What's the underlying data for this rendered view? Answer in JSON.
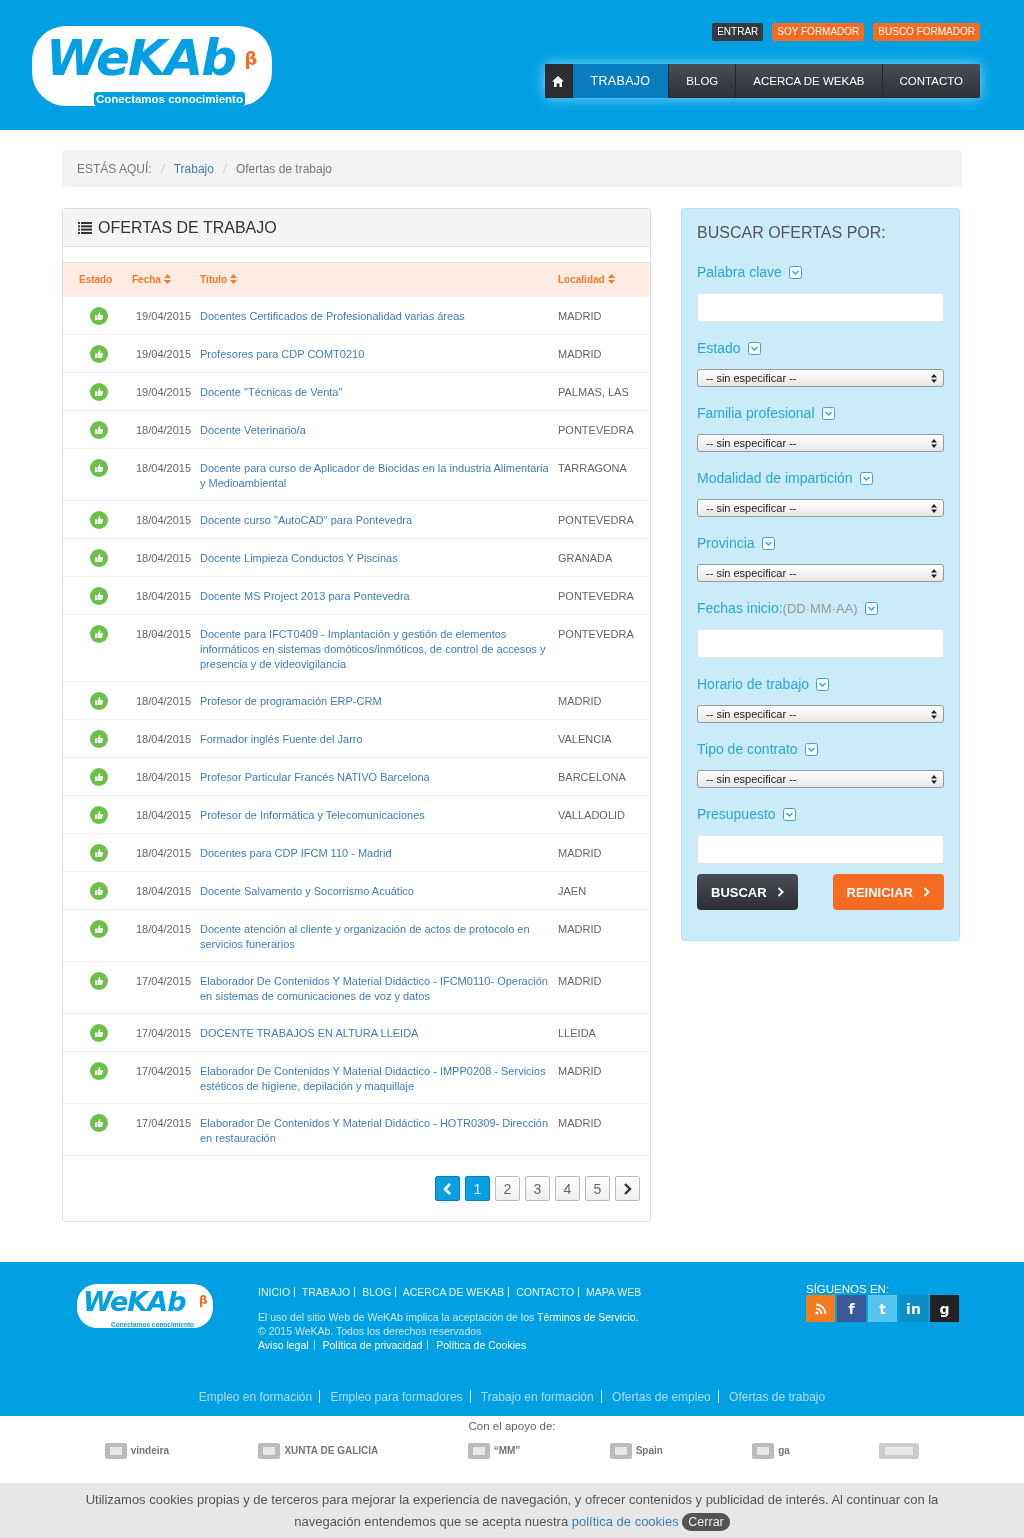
{
  "header": {
    "logo": {
      "name": "WeKAb",
      "beta": "β",
      "tagline": "Conectamos conocimiento"
    },
    "top_buttons": [
      {
        "label": "ENTRAR",
        "kind": "dark"
      },
      {
        "label": "SOY FORMADOR",
        "kind": "orange"
      },
      {
        "label": "BUSCO FORMADOR",
        "kind": "orange"
      }
    ],
    "nav": [
      {
        "label": "TRABAJO",
        "selected": true
      },
      {
        "label": "BLOG",
        "selected": false
      },
      {
        "label": "ACERCA DE WEKAB",
        "selected": false
      },
      {
        "label": "CONTACTO",
        "selected": false
      }
    ]
  },
  "breadcrumb": {
    "prefix": "ESTÁS AQUÍ:",
    "items": [
      {
        "label": "Trabajo",
        "link": true
      },
      {
        "label": "Ofertas de trabajo",
        "link": false
      }
    ]
  },
  "offers": {
    "title": "OFERTAS DE TRABAJO",
    "columns": [
      {
        "label": "Estado",
        "sortable": false
      },
      {
        "label": "Fecha",
        "sortable": true
      },
      {
        "label": "Título",
        "sortable": true
      },
      {
        "label": "Localidad",
        "sortable": true
      }
    ],
    "rows": [
      {
        "date": "19/04/2015",
        "title": "Docentes Certificados de Profesionalidad varias áreas",
        "location": "MADRID"
      },
      {
        "date": "19/04/2015",
        "title": "Profesores para CDP COMT0210",
        "location": "MADRID"
      },
      {
        "date": "19/04/2015",
        "title": "Docente \"Técnicas de Venta\"",
        "location": "PALMAS, LAS"
      },
      {
        "date": "18/04/2015",
        "title": "Docente Veterinario/a",
        "location": "PONTEVEDRA"
      },
      {
        "date": "18/04/2015",
        "title": "Docente para curso de Aplicador de Biocidas en la industria Alimentaria y Medioambiental",
        "location": "TARRAGONA"
      },
      {
        "date": "18/04/2015",
        "title": "Docente curso \"AutoCAD\" para Pontevedra",
        "location": "PONTEVEDRA"
      },
      {
        "date": "18/04/2015",
        "title": "Docente Limpieza Conductos Y Piscinas",
        "location": "GRANADA"
      },
      {
        "date": "18/04/2015",
        "title": "Docente MS Project 2013 para Pontevedra",
        "location": "PONTEVEDRA"
      },
      {
        "date": "18/04/2015",
        "title": "Docente para IFCT0409 - Implantación y gestión de elementos informáticos en sistemas domóticos/inmóticos, de control de accesos y presencia y de videovigilancia",
        "location": "PONTEVEDRA"
      },
      {
        "date": "18/04/2015",
        "title": "Profesor de programación ERP-CRM",
        "location": "MADRID"
      },
      {
        "date": "18/04/2015",
        "title": "Formador inglés Fuente del Jarro",
        "location": "VALENCIA"
      },
      {
        "date": "18/04/2015",
        "title": "Profesor Particular Francés NATIVO Barcelona",
        "location": "BARCELONA"
      },
      {
        "date": "18/04/2015",
        "title": "Profesor de Informática y Telecomunicaciones",
        "location": "VALLADOLID"
      },
      {
        "date": "18/04/2015",
        "title": "Docentes para CDP IFCM 110 - Madrid",
        "location": "MADRID"
      },
      {
        "date": "18/04/2015",
        "title": "Docente Salvamento y Socorrismo Acuático",
        "location": "JAEN"
      },
      {
        "date": "18/04/2015",
        "title": "Docente atención al cliente y organización de actos de protocolo en servicios funerarios",
        "location": "MADRID"
      },
      {
        "date": "17/04/2015",
        "title": "Elaborador De Contenidos Y Material Didáctico - IFCM0110- Operación en sistemas de comunicaciones de voz y datos",
        "location": "MADRID"
      },
      {
        "date": "17/04/2015",
        "title": "DOCENTE TRABAJOS EN ALTURA LLEIDA",
        "location": "LLEIDA"
      },
      {
        "date": "17/04/2015",
        "title": "Elaborador De Contenidos Y Material Didáctico - IMPP0208 - Servicios estéticos de higiene, depilación y maquillaje",
        "location": "MADRID"
      },
      {
        "date": "17/04/2015",
        "title": "Elaborador De Contenidos Y Material Didáctico - HOTR0309- Dirección en restauración",
        "location": "MADRID"
      }
    ],
    "pagination": [
      {
        "label": "1",
        "selected": true
      },
      {
        "label": "2",
        "selected": false
      },
      {
        "label": "3",
        "selected": false
      },
      {
        "label": "4",
        "selected": false
      },
      {
        "label": "5",
        "selected": false
      }
    ]
  },
  "search": {
    "title": "BUSCAR OFERTAS POR:",
    "filters": [
      {
        "label": "Palabra clave",
        "kind": "text"
      },
      {
        "label": "Estado",
        "kind": "select",
        "value": "-- sin especificar --"
      },
      {
        "label": "Familia profesional",
        "kind": "select",
        "value": "-- sin especificar --"
      },
      {
        "label": "Modalidad de impartición",
        "kind": "select",
        "value": "-- sin especificar --"
      },
      {
        "label": "Provincia",
        "kind": "select",
        "value": "-- sin especificar --"
      },
      {
        "label": "Fechas inicio:",
        "hint": "(DD·MM·AA)",
        "kind": "text"
      },
      {
        "label": "Horario de trabajo",
        "kind": "select",
        "value": "-- sin especificar --"
      },
      {
        "label": "Tipo de contrato",
        "kind": "select",
        "value": "-- sin especificar --"
      },
      {
        "label": "Presupuesto",
        "kind": "text"
      }
    ],
    "buttons": [
      {
        "label": "BUSCAR",
        "kind": "dark"
      },
      {
        "label": "REINICIAR",
        "kind": "orange"
      }
    ]
  },
  "footer": {
    "logo": {
      "name": "WeKAb",
      "beta": "β",
      "tagline": "Conectamos conocimiento"
    },
    "links": [
      "INICIO",
      "TRABAJO",
      "BLOG",
      "ACERCA DE WEKAB",
      "CONTACTO",
      "MAPA WEB"
    ],
    "terms_text": "El uso del sitio Web de WeKAb implica la aceptación de los",
    "terms_link": "Términos de Servicio.",
    "copyright": "© 2015 WeKAb. Todos los derechos reservados",
    "legal_links": [
      "Aviso legal",
      "Política de privacidad",
      "Política de Cookies"
    ],
    "follow_title": "SÍGUENOS EN:",
    "social": [
      {
        "kind": "rss"
      },
      {
        "kind": "facebook",
        "glyph": "f"
      },
      {
        "kind": "twitter",
        "glyph": "t"
      },
      {
        "kind": "linkedin",
        "glyph": "in"
      },
      {
        "kind": "google",
        "glyph": "g"
      }
    ],
    "seo_links": [
      "Empleo en formación",
      "Empleo para formadores",
      "Trabajo en formación",
      "Ofertas de empleo",
      "Ofertas de trabajo"
    ]
  },
  "sponsors": {
    "title": "Con el apoyo de:",
    "items": [
      {
        "name": "vindeira"
      },
      {
        "name": "XUNTA DE GALICIA"
      },
      {
        "name": "“MM”"
      },
      {
        "name": "Spain"
      },
      {
        "name": "ga"
      }
    ]
  },
  "cookie_bar": {
    "text": "Utilizamos cookies propias y de terceros para mejorar la experiencia de navegación, y ofrecer contenidos y publicidad de interés. Al continuar con la navegación entendemos que se acepta nuestra",
    "link": "política de cookies",
    "button": "Cerrar"
  }
}
